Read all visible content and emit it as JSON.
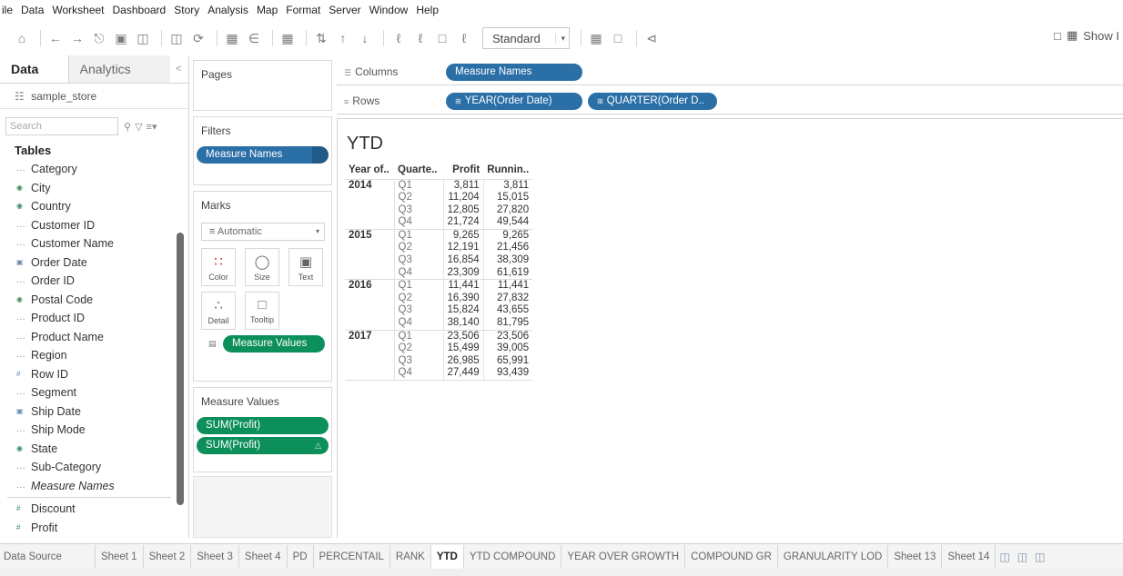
{
  "menu": [
    "ile",
    "Data",
    "Worksheet",
    "Dashboard",
    "Story",
    "Analysis",
    "Map",
    "Format",
    "Server",
    "Window",
    "Help"
  ],
  "toolbar": {
    "standard_label": "Standard",
    "show_me_label": "Show I"
  },
  "data_pane": {
    "tab_data": "Data",
    "tab_analytics": "Analytics",
    "collapse_glyph": "<",
    "datasource": "sample_store",
    "search_placeholder": "Search",
    "tables_heading": "Tables",
    "dimensions": [
      {
        "label": "Category",
        "icon": "Abc"
      },
      {
        "label": "City",
        "icon": "geo"
      },
      {
        "label": "Country",
        "icon": "geo"
      },
      {
        "label": "Customer ID",
        "icon": "Abc"
      },
      {
        "label": "Customer Name",
        "icon": "Abc"
      },
      {
        "label": "Order Date",
        "icon": "date"
      },
      {
        "label": "Order ID",
        "icon": "Abc"
      },
      {
        "label": "Postal Code",
        "icon": "geo"
      },
      {
        "label": "Product ID",
        "icon": "Abc"
      },
      {
        "label": "Product Name",
        "icon": "Abc"
      },
      {
        "label": "Region",
        "icon": "Abc"
      },
      {
        "label": "Row ID",
        "icon": "num"
      },
      {
        "label": "Segment",
        "icon": "Abc"
      },
      {
        "label": "Ship Date",
        "icon": "date"
      },
      {
        "label": "Ship Mode",
        "icon": "Abc"
      },
      {
        "label": "State",
        "icon": "geo"
      },
      {
        "label": "Sub-Category",
        "icon": "Abc"
      },
      {
        "label": "Measure Names",
        "icon": "Abc",
        "italic": true
      }
    ],
    "measures": [
      {
        "label": "Discount",
        "icon": "num"
      },
      {
        "label": "Profit",
        "icon": "num"
      }
    ]
  },
  "cards": {
    "pages_title": "Pages",
    "filters_title": "Filters",
    "filter_pill": "Measure Names",
    "marks_title": "Marks",
    "marks_type": "Automatic",
    "mark_buttons": {
      "color": "Color",
      "size": "Size",
      "text": "Text",
      "detail": "Detail",
      "tooltip": "Tooltip"
    },
    "marks_pill": "Measure Values",
    "measure_values_title": "Measure Values",
    "measure_values_pills": [
      "SUM(Profit)",
      "SUM(Profit)"
    ]
  },
  "shelves": {
    "columns_label": "Columns",
    "rows_label": "Rows",
    "columns_pill": "Measure Names",
    "rows_pills": [
      "YEAR(Order Date)",
      "QUARTER(Order D.."
    ]
  },
  "view": {
    "title": "YTD",
    "headers": [
      "Year of..",
      "Quarte..",
      "Profit",
      "Runnin.."
    ],
    "groups": [
      {
        "year": "2014",
        "rows": [
          [
            "Q1",
            "3,811",
            "3,811"
          ],
          [
            "Q2",
            "11,204",
            "15,015"
          ],
          [
            "Q3",
            "12,805",
            "27,820"
          ],
          [
            "Q4",
            "21,724",
            "49,544"
          ]
        ]
      },
      {
        "year": "2015",
        "rows": [
          [
            "Q1",
            "9,265",
            "9,265"
          ],
          [
            "Q2",
            "12,191",
            "21,456"
          ],
          [
            "Q3",
            "16,854",
            "38,309"
          ],
          [
            "Q4",
            "23,309",
            "61,619"
          ]
        ]
      },
      {
        "year": "2016",
        "rows": [
          [
            "Q1",
            "11,441",
            "11,441"
          ],
          [
            "Q2",
            "16,390",
            "27,832"
          ],
          [
            "Q3",
            "15,824",
            "43,655"
          ],
          [
            "Q4",
            "38,140",
            "81,795"
          ]
        ]
      },
      {
        "year": "2017",
        "rows": [
          [
            "Q1",
            "23,506",
            "23,506"
          ],
          [
            "Q2",
            "15,499",
            "39,005"
          ],
          [
            "Q3",
            "26,985",
            "65,991"
          ],
          [
            "Q4",
            "27,449",
            "93,439"
          ]
        ]
      }
    ]
  },
  "sheet_tabs": {
    "data_source": "Data Source",
    "tabs": [
      "Sheet 1",
      "Sheet 2",
      "Sheet 3",
      "Sheet 4",
      "PD",
      "PERCENTAIL",
      "RANK",
      "YTD",
      "YTD COMPOUND",
      "YEAR OVER GROWTH",
      "COMPOUND GR",
      "GRANULARITY LOD",
      "Sheet 13",
      "Sheet 14"
    ],
    "active": "YTD"
  },
  "colors": {
    "dimension_pill": "#2b6fa7",
    "measure_pill": "#0d8f5c"
  }
}
